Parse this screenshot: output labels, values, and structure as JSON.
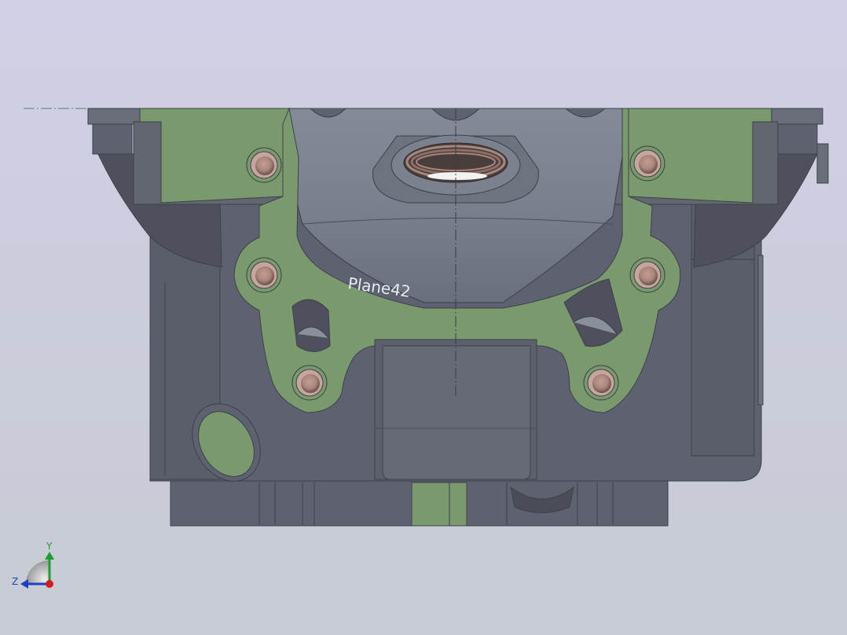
{
  "viewport": {
    "background_top": "#d0d0e6",
    "background_bottom": "#c7cbd3"
  },
  "model": {
    "section_color": "#7a9a6e",
    "body_color": "#5c606c",
    "body_light": "#6e7380",
    "body_dark": "#454853",
    "bore_color": "#a8877e",
    "plane_label": "Plane42"
  },
  "triad": {
    "y_label": "Y",
    "z_label": "Z",
    "y_color": "#1b9e2a",
    "z_color": "#1f3fc4",
    "x_color": "#d21c1c"
  }
}
